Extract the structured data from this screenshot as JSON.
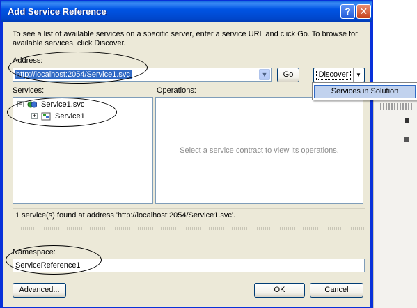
{
  "window": {
    "title": "Add Service Reference",
    "help_glyph": "?",
    "close_glyph": "✕"
  },
  "description": "To see a list of available services on a specific server, enter a service URL and click Go. To browse for available services, click Discover.",
  "address": {
    "label": "Address:",
    "value": "http://localhost:2054/Service1.svc",
    "go_label": "Go",
    "discover_label": "Discover",
    "discover_menu": [
      "Services in Solution"
    ]
  },
  "services": {
    "label": "Services:",
    "tree": [
      {
        "label": "Service1.svc",
        "expanded": true,
        "icon": "service-file-icon"
      },
      {
        "label": "Service1",
        "expanded": false,
        "icon": "service-class-icon"
      }
    ]
  },
  "operations": {
    "label": "Operations:",
    "empty_message": "Select a service contract to view its operations."
  },
  "status": "1 service(s) found at address 'http://localhost:2054/Service1.svc'.",
  "namespace": {
    "label": "Namespace:",
    "value": "ServiceReference1"
  },
  "buttons": {
    "advanced": "Advanced...",
    "ok": "OK",
    "cancel": "Cancel"
  },
  "colors": {
    "titlebar": "#0055e5",
    "selection": "#316ac5",
    "dialog": "#ece9d8"
  }
}
